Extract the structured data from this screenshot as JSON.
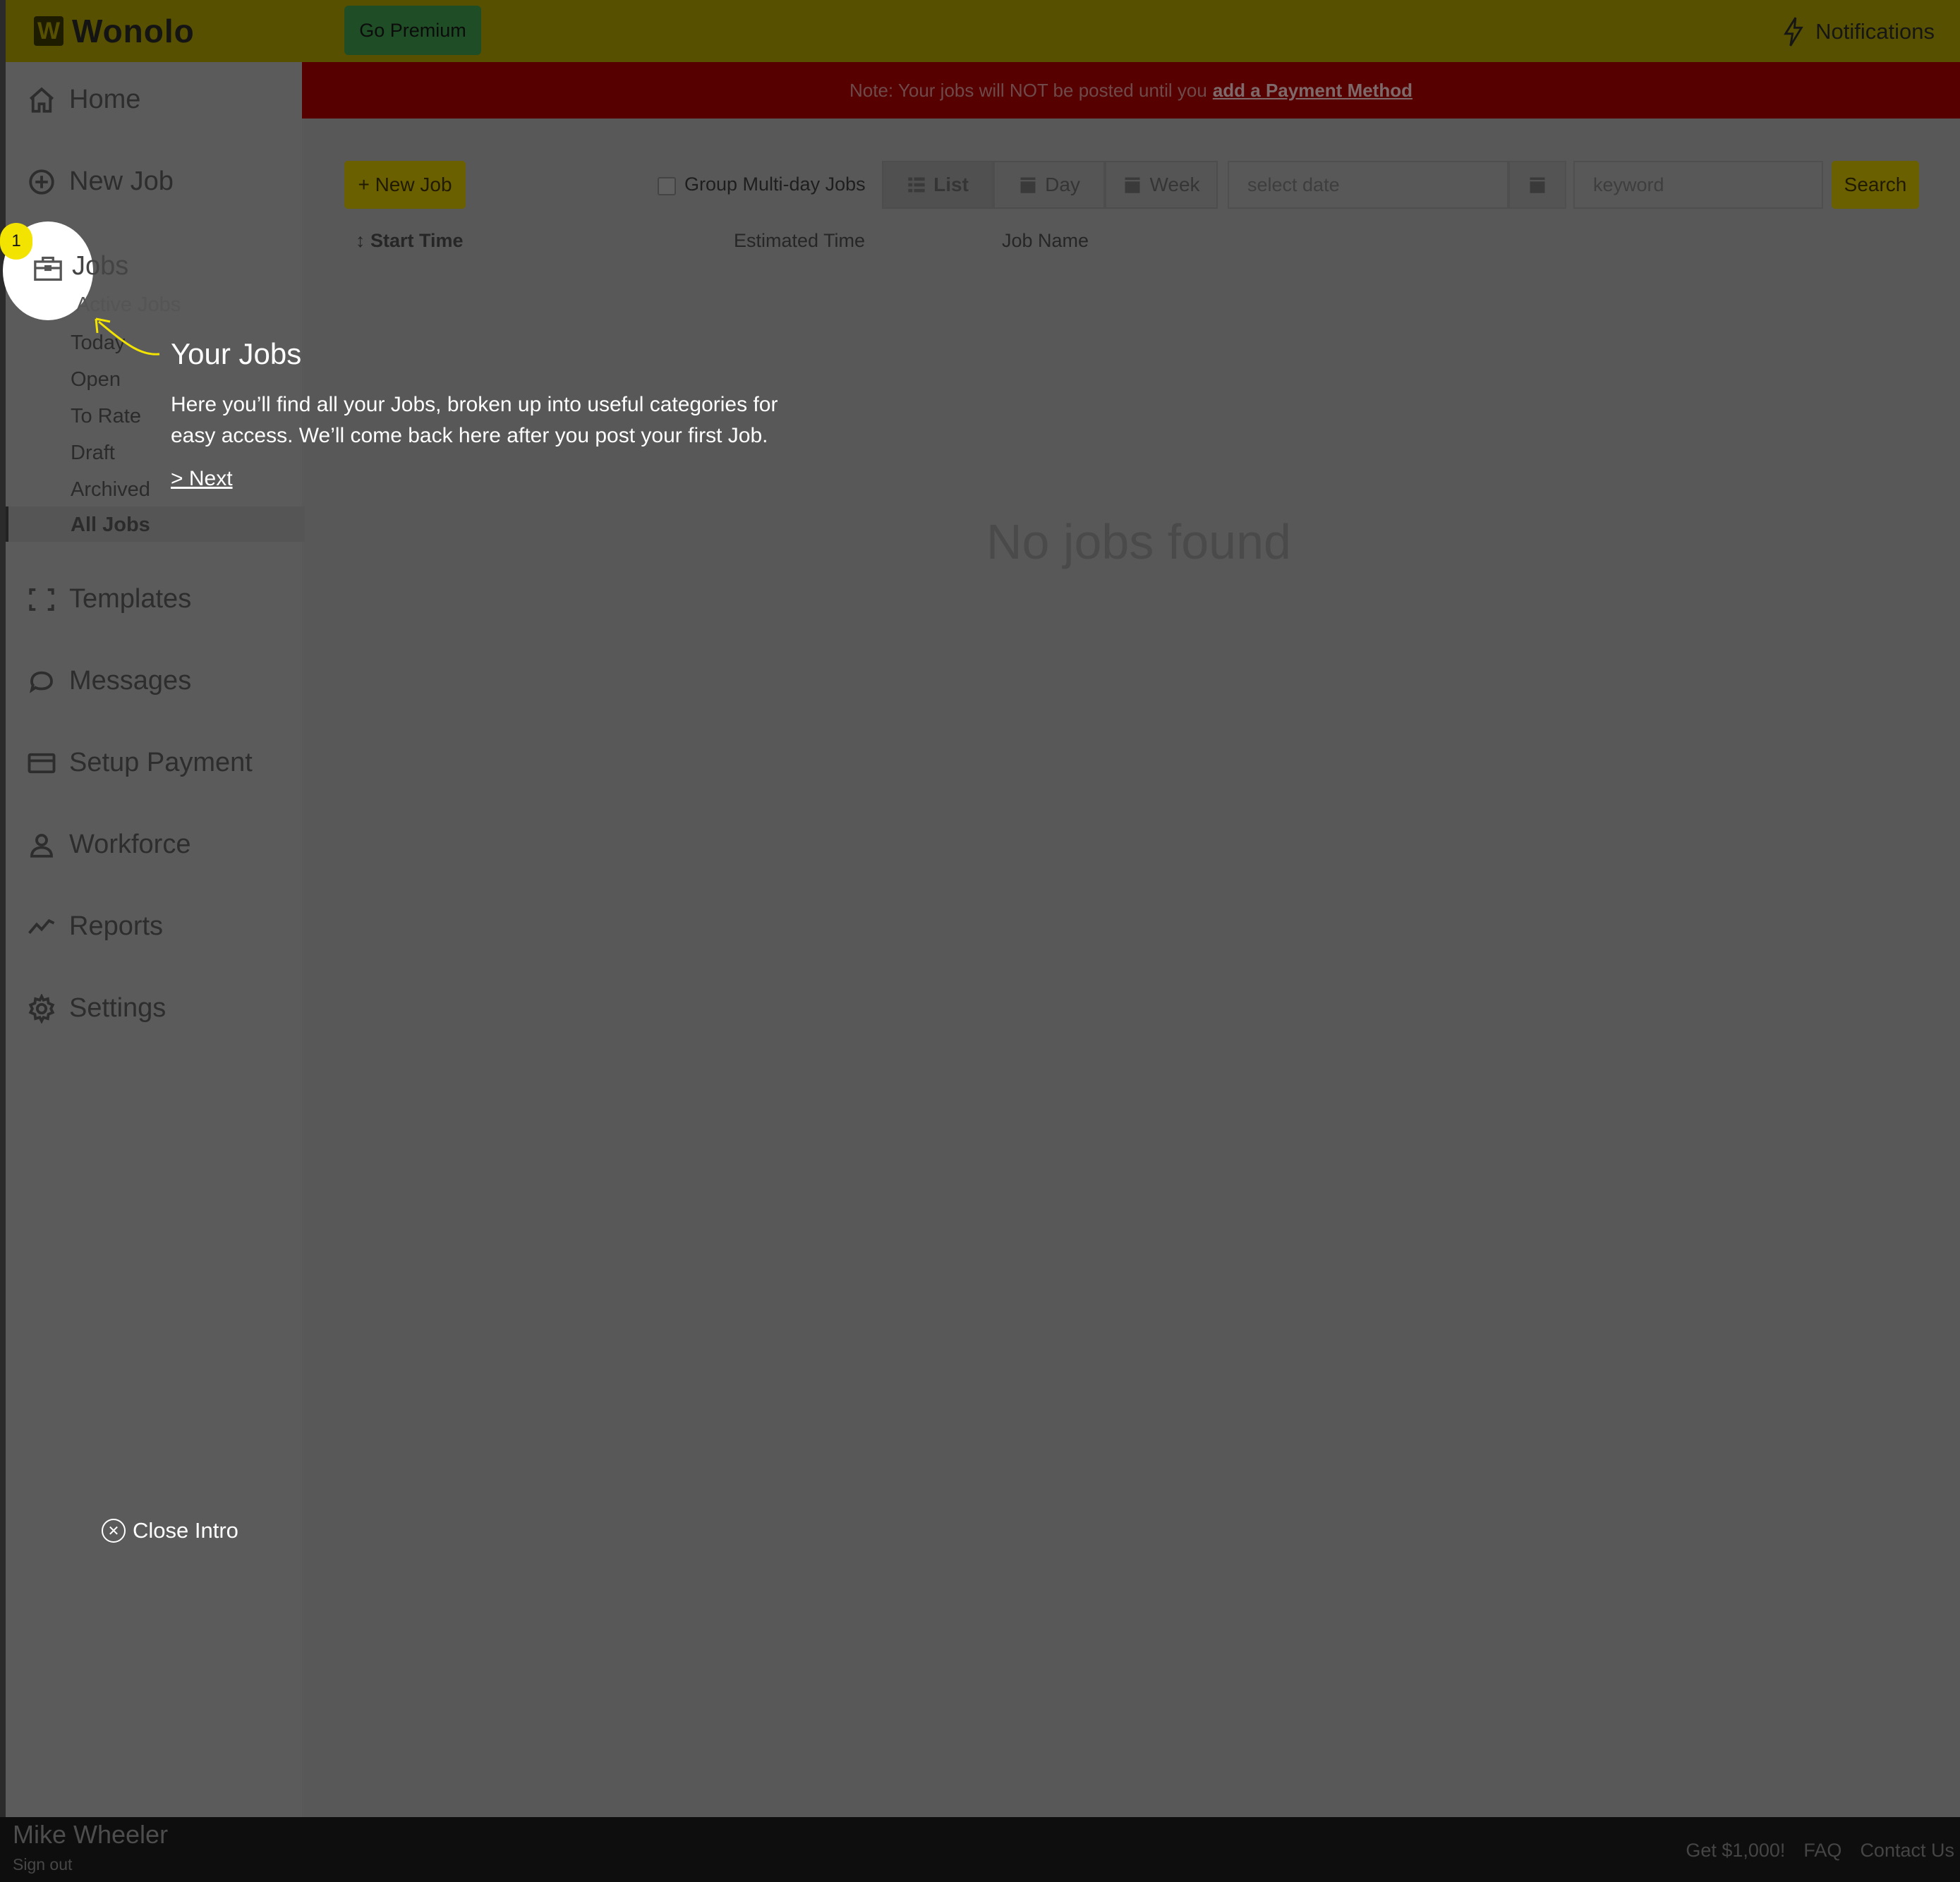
{
  "header": {
    "logo_letter": "W",
    "logo_text": "Wonolo",
    "go_premium": "Go Premium",
    "notifications": "Notifications"
  },
  "banner": {
    "text": "Note: Your jobs will NOT be posted until you",
    "link": "add a Payment Method"
  },
  "sidebar": {
    "home": "Home",
    "new_job": "New Job",
    "jobs": "Jobs",
    "sub": {
      "active": "Active Jobs",
      "today": "Today",
      "open": "Open",
      "to_rate": "To Rate",
      "draft": "Draft",
      "archived": "Archived",
      "all": "All Jobs"
    },
    "templates": "Templates",
    "messages": "Messages",
    "setup_payment": "Setup Payment",
    "workforce": "Workforce",
    "reports": "Reports",
    "settings": "Settings"
  },
  "tour": {
    "step": "1",
    "title": "Your Jobs",
    "body": "Here you’ll find all your Jobs, broken up into useful categories for easy access. We’ll come back here after you post your first Job.",
    "next": "> Next",
    "close": "Close Intro"
  },
  "toolbar": {
    "new_job": "+ New Job",
    "group_label": "Group Multi-day Jobs",
    "group_checked": false,
    "view_list": "List",
    "view_day": "Day",
    "view_week": "Week",
    "date_placeholder": "select date",
    "keyword_placeholder": "keyword",
    "search": "Search"
  },
  "table": {
    "col_start": "↕ Start Time",
    "col_est": "Estimated Time",
    "col_name": "Job Name",
    "empty": "No jobs found"
  },
  "footer": {
    "user": "Mike Wheeler",
    "sign_out": "Sign out",
    "links": [
      "Get $1,000!",
      "FAQ",
      "Contact Us"
    ]
  }
}
